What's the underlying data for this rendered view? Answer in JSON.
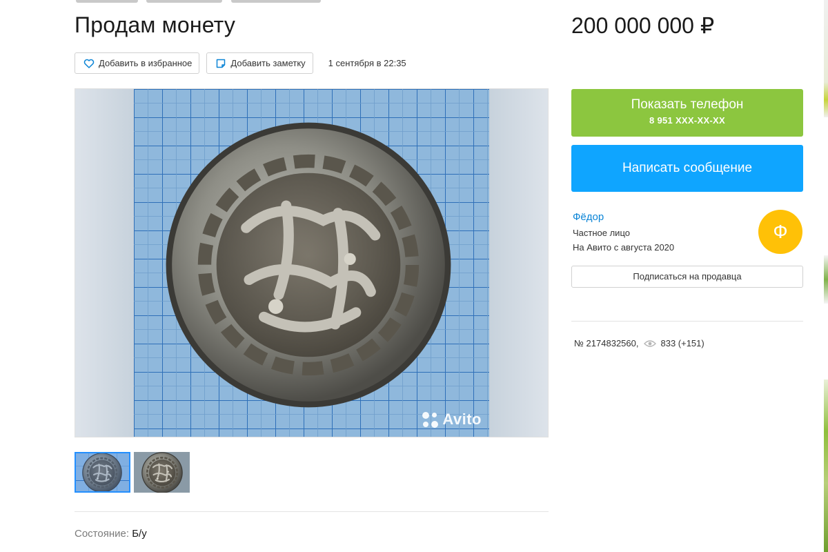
{
  "listing": {
    "title": "Продам монету",
    "price": "200 000 000 ₽",
    "date": "1 сентября в 22:35",
    "condition_label": "Состояние:",
    "condition_value": "Б/у",
    "item_number": "№ 2174832560,",
    "views": "833 (+151)"
  },
  "actions": {
    "favorite_label": "Добавить в избранное",
    "note_label": "Добавить заметку"
  },
  "gallery": {
    "watermark": "Avito",
    "thumbnails": [
      {
        "selected": true
      },
      {
        "selected": false
      }
    ]
  },
  "contact": {
    "show_phone_label": "Показать телефон",
    "phone_masked": "8 951 XXX-XX-XX",
    "write_message_label": "Написать сообщение",
    "subscribe_label": "Подписаться на продавца"
  },
  "seller": {
    "name": "Фёдор",
    "type": "Частное лицо",
    "since": "На Авито с августа 2020",
    "avatar_letter": "Ф"
  },
  "colors": {
    "phone_button": "#8cc63f",
    "message_button": "#0fa5ff",
    "avatar": "#ffc107",
    "link": "#0a84d6"
  },
  "icons": {
    "favorite": "heart-icon",
    "note": "note-icon",
    "views": "eye-icon"
  }
}
